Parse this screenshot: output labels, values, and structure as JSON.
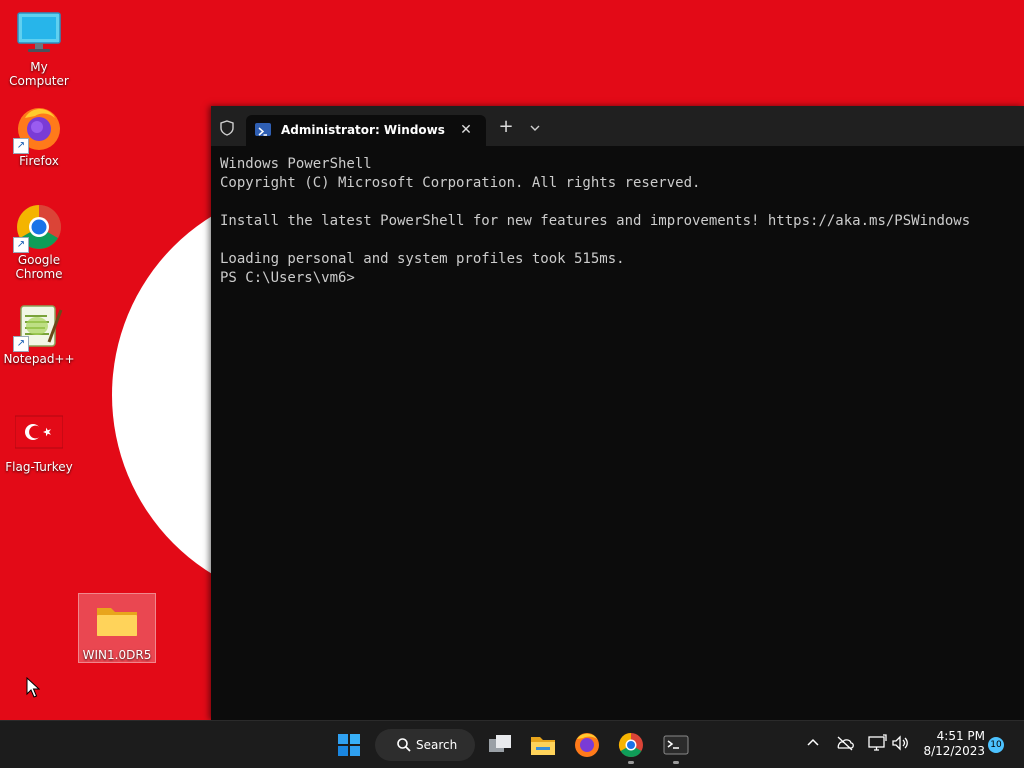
{
  "desktop": {
    "icons": [
      {
        "label": "My Computer"
      },
      {
        "label": "Firefox"
      },
      {
        "label": "Google Chrome"
      },
      {
        "label": "Notepad++"
      },
      {
        "label": "Flag-Turkey"
      },
      {
        "label": "WIN1.0DR5"
      }
    ],
    "wallpaper_color": "#e30a17"
  },
  "terminal": {
    "tab_title": "Administrator: Windows PowerShell",
    "new_tab_symbol": "+",
    "close_symbol": "✕",
    "lines": [
      "Windows PowerShell",
      "Copyright (C) Microsoft Corporation. All rights reserved.",
      "",
      "Install the latest PowerShell for new features and improvements! https://aka.ms/PSWindows",
      "",
      "Loading personal and system profiles took 515ms.",
      "PS C:\\Users\\vm6>"
    ]
  },
  "taskbar": {
    "search_label": "Search",
    "time": "4:51 PM",
    "date": "8/12/2023",
    "notification_count": "10"
  }
}
